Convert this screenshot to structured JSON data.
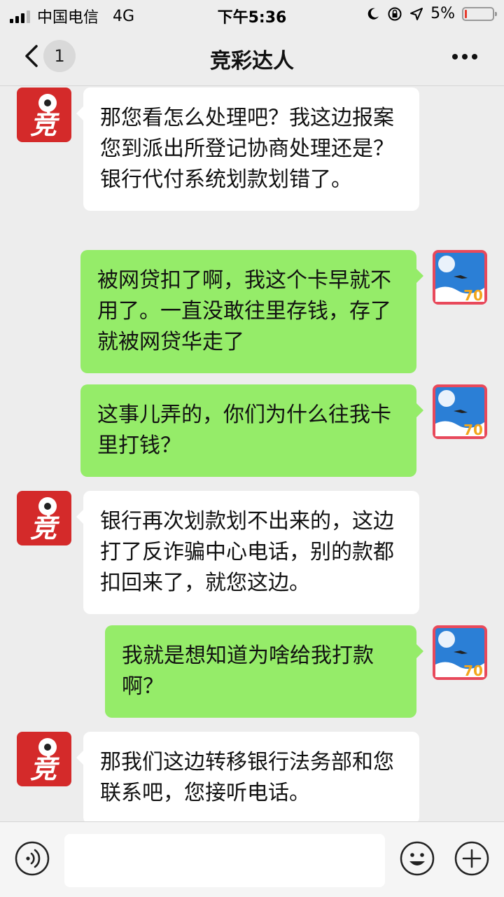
{
  "status_bar": {
    "carrier": "中国电信",
    "network": "4G",
    "time": "下午5:36",
    "battery_percent": "5%",
    "battery_level": 0.05
  },
  "nav": {
    "title": "竞彩达人",
    "unread_badge": "1"
  },
  "messages": [
    {
      "side": "received",
      "text": "那您看怎么处理吧？我这边报案您到派出所登记协商处理还是？银行代付系统划款划错了。"
    },
    {
      "side": "sent",
      "text": "被网贷扣了啊，我这个卡早就不用了。一直没敢往里存钱，存了就被网贷华走了"
    },
    {
      "side": "sent",
      "text": "这事儿弄的，你们为什么往我卡里打钱？"
    },
    {
      "side": "received",
      "text": "银行再次划款划不出来的，这边打了反诈骗中心电话，别的款都扣回来了，就您这边。"
    },
    {
      "side": "sent",
      "text": "我就是想知道为啥给我打款啊？"
    },
    {
      "side": "received",
      "text": "那我们这边转移银行法务部和您联系吧，您接听电话。"
    }
  ],
  "contact_avatar_text": "竞",
  "user_avatar_text": "70",
  "input": {
    "value": ""
  },
  "icons": {
    "back": "back-arrow-icon",
    "more": "more-dots-icon",
    "voice": "voice-input-icon",
    "emoji": "emoji-icon",
    "plus": "plus-icon"
  },
  "colors": {
    "sent_bubble": "#95ec69",
    "received_bubble": "#ffffff",
    "background": "#ededed",
    "contact_avatar": "#d42a2a"
  }
}
